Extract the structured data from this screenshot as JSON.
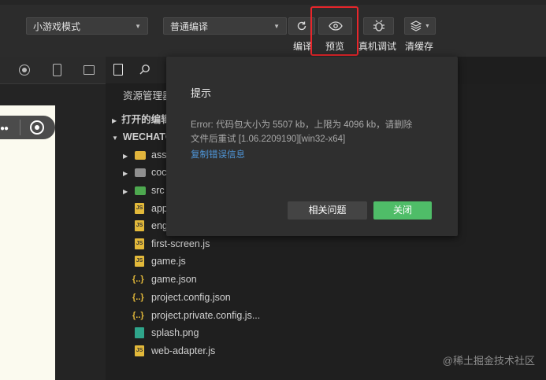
{
  "toolbar": {
    "mode_select": "小游戏模式",
    "compile_select": "普通编译",
    "labels": {
      "compile": "编译",
      "preview": "预览",
      "real_debug": "真机调试",
      "clear_cache": "清缓存"
    }
  },
  "explorer": {
    "title": "资源管理器",
    "open_editors": "打开的编辑",
    "project": "WECHATG",
    "folders": [
      "ass",
      "coc",
      "src"
    ],
    "files": [
      {
        "name": "app",
        "type": "js"
      },
      {
        "name": "eng",
        "type": "js"
      },
      {
        "name": "first-screen.js",
        "type": "js"
      },
      {
        "name": "game.js",
        "type": "js"
      },
      {
        "name": "game.json",
        "type": "json"
      },
      {
        "name": "project.config.json",
        "type": "json"
      },
      {
        "name": "project.private.config.js...",
        "type": "json"
      },
      {
        "name": "splash.png",
        "type": "png"
      },
      {
        "name": "web-adapter.js",
        "type": "js"
      }
    ]
  },
  "dialog": {
    "title": "提示",
    "message_line1": "Error: 代码包大小为 5507 kb，上限为 4096 kb，请删除",
    "message_line2": "文件后重试 [1.06.2209190][win32-x64]",
    "copy_link": "复制错误信息",
    "related_button": "相关问题",
    "close_button": "关闭"
  },
  "icon_labels": {
    "js": "JS",
    "json": "{..}"
  },
  "watermark": "@稀土掘金技术社区",
  "colors": {
    "highlight": "#e8262b",
    "primary_button": "#4fbd68",
    "link": "#4f96d9"
  }
}
